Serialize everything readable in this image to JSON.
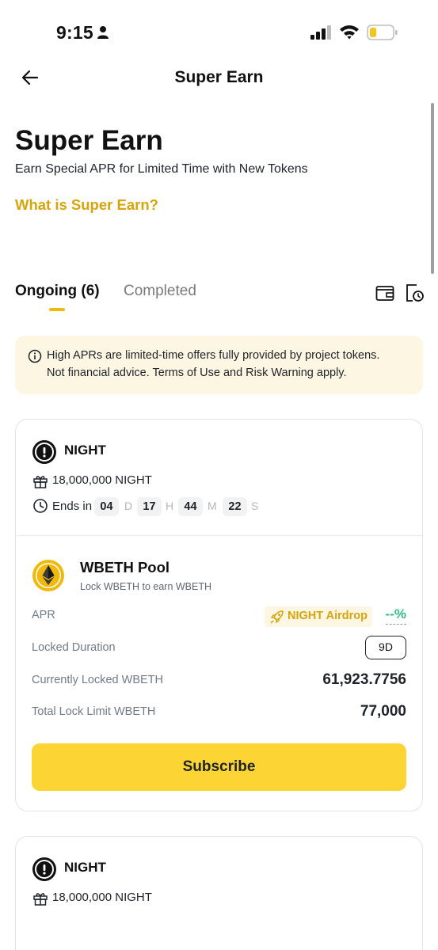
{
  "status_bar": {
    "time": "9:15"
  },
  "nav": {
    "title": "Super Earn"
  },
  "hero": {
    "title": "Super Earn",
    "subtitle": "Earn Special APR for Limited Time with New Tokens",
    "link": "What is Super Earn?"
  },
  "tabs": [
    {
      "label": "Ongoing (6)",
      "active": true
    },
    {
      "label": "Completed",
      "active": false
    }
  ],
  "notice": {
    "line1": "High APRs are limited-time offers fully provided by project tokens.",
    "line2": "Not financial advice. Terms of Use and Risk Warning apply."
  },
  "cards": [
    {
      "token": "NIGHT",
      "reward": "18,000,000 NIGHT",
      "ends_label": "Ends in",
      "countdown": [
        {
          "value": "04",
          "unit": "D"
        },
        {
          "value": "17",
          "unit": "H"
        },
        {
          "value": "44",
          "unit": "M"
        },
        {
          "value": "22",
          "unit": "S"
        }
      ],
      "pool": {
        "name": "WBETH Pool",
        "subtitle": "Lock WBETH to earn WBETH",
        "apr_label": "APR",
        "airdrop_badge": "NIGHT Airdrop",
        "apr_value": "--%",
        "locked_duration_label": "Locked Duration",
        "locked_duration_value": "9D",
        "currently_locked_label": "Currently Locked WBETH",
        "currently_locked_value": "61,923.7756",
        "total_limit_label": "Total Lock Limit WBETH",
        "total_limit_value": "77,000",
        "subscribe_label": "Subscribe"
      }
    },
    {
      "token": "NIGHT",
      "reward": "18,000,000 NIGHT"
    }
  ],
  "colors": {
    "accent": "#f0b90b",
    "link": "#d7a40a",
    "button": "#fcd535",
    "notice_bg": "#fdf6e3",
    "apr_green": "#2ebd85",
    "eth_gold": "#f0b90b"
  }
}
